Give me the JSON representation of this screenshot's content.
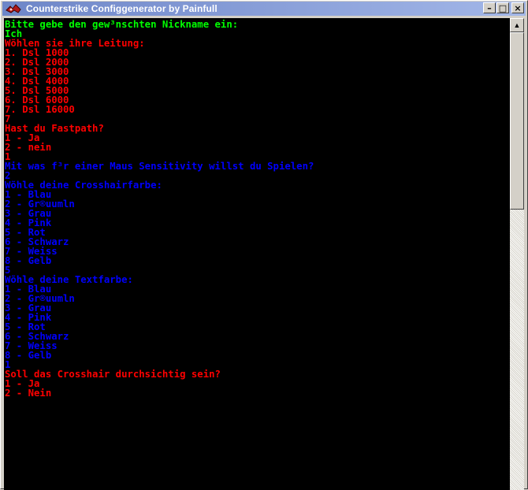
{
  "window": {
    "title": "Counterstrike Configgenerator by Painfull",
    "controls": {
      "minimize": "–",
      "maximize": "□",
      "close": "×"
    }
  },
  "colors": {
    "green": "#00ff00",
    "red": "#ff0000",
    "blue": "#0000ff"
  },
  "console": {
    "lines": [
      {
        "text": "Bitte gebe den gew³nschten Nickname ein:",
        "color": "green"
      },
      {
        "text": "Ich",
        "color": "green"
      },
      {
        "text": "Wõhlen sie ihre Leitung:",
        "color": "red"
      },
      {
        "text": "1. Dsl 1000",
        "color": "red"
      },
      {
        "text": "2. Dsl 2000",
        "color": "red"
      },
      {
        "text": "3. Dsl 3000",
        "color": "red"
      },
      {
        "text": "4. Dsl 4000",
        "color": "red"
      },
      {
        "text": "5. Dsl 5000",
        "color": "red"
      },
      {
        "text": "6. Dsl 6000",
        "color": "red"
      },
      {
        "text": "7. Dsl 16000",
        "color": "red"
      },
      {
        "text": "7",
        "color": "red"
      },
      {
        "text": "Hast du Fastpath?",
        "color": "red"
      },
      {
        "text": "1 - Ja",
        "color": "red"
      },
      {
        "text": "2 - nein",
        "color": "red"
      },
      {
        "text": "1",
        "color": "red"
      },
      {
        "text": "Mit was f³r einer Maus Sensitivity willst du Spielen?",
        "color": "blue"
      },
      {
        "text": "2",
        "color": "blue"
      },
      {
        "text": "Wõhle deine Crosshairfarbe:",
        "color": "blue"
      },
      {
        "text": "1 - Blau",
        "color": "blue"
      },
      {
        "text": "2 - Gr®uumln",
        "color": "blue"
      },
      {
        "text": "3 - Grau",
        "color": "blue"
      },
      {
        "text": "4 - Pink",
        "color": "blue"
      },
      {
        "text": "5 - Rot",
        "color": "blue"
      },
      {
        "text": "6 - Schwarz",
        "color": "blue"
      },
      {
        "text": "7 - Weiss",
        "color": "blue"
      },
      {
        "text": "8 - Gelb",
        "color": "blue"
      },
      {
        "text": "5",
        "color": "blue"
      },
      {
        "text": "Wõhle deine Textfarbe:",
        "color": "blue"
      },
      {
        "text": "1 - Blau",
        "color": "blue"
      },
      {
        "text": "2 - Gr®uumln",
        "color": "blue"
      },
      {
        "text": "3 - Grau",
        "color": "blue"
      },
      {
        "text": "4 - Pink",
        "color": "blue"
      },
      {
        "text": "5 - Rot",
        "color": "blue"
      },
      {
        "text": "6 - Schwarz",
        "color": "blue"
      },
      {
        "text": "7 - Weiss",
        "color": "blue"
      },
      {
        "text": "8 - Gelb",
        "color": "blue"
      },
      {
        "text": "1",
        "color": "blue"
      },
      {
        "text": "Soll das Crosshair durchsichtig sein?",
        "color": "red"
      },
      {
        "text": "1 - Ja",
        "color": "red"
      },
      {
        "text": "2 - Nein",
        "color": "red"
      }
    ]
  },
  "scrollbar": {
    "up_arrow": "▲"
  }
}
